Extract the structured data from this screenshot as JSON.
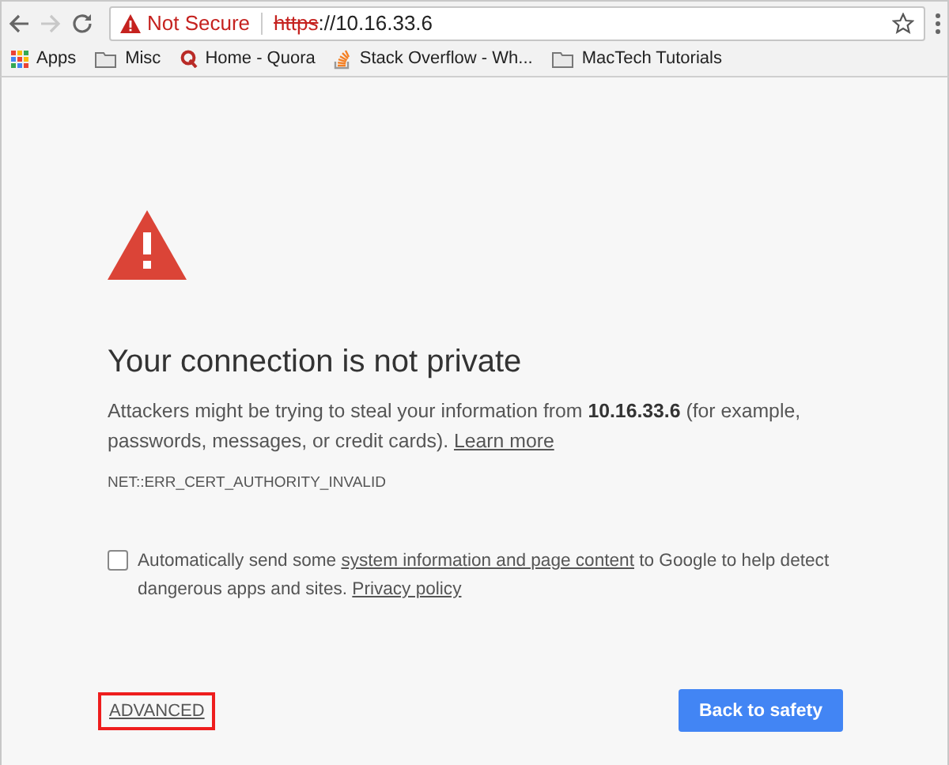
{
  "toolbar": {
    "security_label": "Not Secure",
    "url_scheme": "https",
    "url_rest": "://10.16.33.6",
    "back_disabled": false,
    "forward_disabled": true
  },
  "bookmarks": [
    {
      "kind": "apps",
      "label": "Apps"
    },
    {
      "kind": "folder",
      "label": "Misc"
    },
    {
      "kind": "quora",
      "label": "Home - Quora"
    },
    {
      "kind": "stack",
      "label": "Stack Overflow - Wh..."
    },
    {
      "kind": "folder",
      "label": "MacTech Tutorials"
    }
  ],
  "interstitial": {
    "title": "Your connection is not private",
    "message": "Attackers might be trying to steal your information from **10.16.33.6** (for example, passwords, messages, or credit cards).",
    "learn_more": "Learn more",
    "error_code": "NET::ERR_CERT_AUTHORITY_INVALID",
    "report": {
      "checked": false,
      "parts": [
        {
          "kind": "text",
          "text": "Automatically send some "
        },
        {
          "kind": "link",
          "text": "system information and page content"
        },
        {
          "kind": "text",
          "text": " to Google to help detect dangerous apps and sites. "
        },
        {
          "kind": "link",
          "text": "Privacy policy"
        }
      ]
    },
    "advanced": {
      "label": "ADVANCED",
      "highlighted": true
    },
    "primary_button": "Back to safety"
  }
}
